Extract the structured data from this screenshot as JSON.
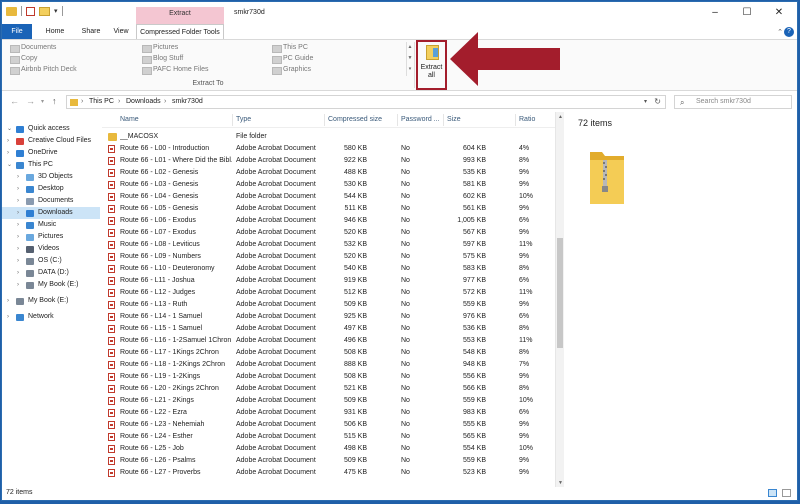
{
  "window": {
    "title": "smkr730d",
    "contextual_tab_label": "Extract"
  },
  "tabs": [
    "File",
    "Home",
    "Share",
    "View",
    "Compressed Folder Tools"
  ],
  "ribbon": {
    "destinations": [
      [
        "Documents",
        "Copy",
        "Airbnb Pitch Deck"
      ],
      [
        "Pictures",
        "Blog Stuff",
        "PAFC Home Files"
      ],
      [
        "This PC",
        "PC Guide",
        "Graphics"
      ]
    ],
    "group_label": "Extract To",
    "extract_all": [
      "Extract",
      "all"
    ]
  },
  "address": {
    "crumbs": [
      "This PC",
      "Downloads",
      "smkr730d"
    ],
    "search_placeholder": "Search smkr730d"
  },
  "nav": [
    {
      "label": "Quick access",
      "icon": "star-icon",
      "color": "#2f7fd3",
      "level": 0,
      "expanded": true
    },
    {
      "label": "Creative Cloud Files",
      "icon": "creative-cloud-icon",
      "color": "#d9413a",
      "level": 0
    },
    {
      "label": "OneDrive",
      "icon": "cloud-icon",
      "color": "#2f7fd3",
      "level": 0
    },
    {
      "label": "This PC",
      "icon": "pc-icon",
      "color": "#3a86d0",
      "level": 0,
      "expanded": true
    },
    {
      "label": "3D Objects",
      "icon": "cube-icon",
      "color": "#6aa8de",
      "level": 1
    },
    {
      "label": "Desktop",
      "icon": "desktop-icon",
      "color": "#3a86d0",
      "level": 1
    },
    {
      "label": "Documents",
      "icon": "document-icon",
      "color": "#8a9bb0",
      "level": 1
    },
    {
      "label": "Downloads",
      "icon": "download-icon",
      "color": "#2f7fd3",
      "level": 1,
      "selected": true
    },
    {
      "label": "Music",
      "icon": "music-icon",
      "color": "#3a86d0",
      "level": 1
    },
    {
      "label": "Pictures",
      "icon": "picture-icon",
      "color": "#6aa8de",
      "level": 1
    },
    {
      "label": "Videos",
      "icon": "video-icon",
      "color": "#556070",
      "level": 1
    },
    {
      "label": "OS (C:)",
      "icon": "drive-icon",
      "color": "#7a8796",
      "level": 1
    },
    {
      "label": "DATA (D:)",
      "icon": "drive-icon",
      "color": "#7a8796",
      "level": 1
    },
    {
      "label": "My Book (E:)",
      "icon": "drive-icon",
      "color": "#7a8796",
      "level": 1
    },
    {
      "label": "My Book (E:)",
      "icon": "drive-icon",
      "color": "#7a8796",
      "level": 0,
      "gap": true
    },
    {
      "label": "Network",
      "icon": "network-icon",
      "color": "#3a86d0",
      "level": 0,
      "gap": true
    }
  ],
  "columns": [
    "Name",
    "Type",
    "Compressed size",
    "Password ...",
    "Size",
    "Ratio"
  ],
  "files": [
    {
      "name": "__MACOSX",
      "type": "File folder",
      "csize": "",
      "pw": "",
      "size": "",
      "ratio": "",
      "folder": true
    },
    {
      "name": "Route 66 - L00 - Introduction",
      "type": "Adobe Acrobat Document",
      "csize": "580 KB",
      "pw": "No",
      "size": "604 KB",
      "ratio": "4%"
    },
    {
      "name": "Route 66 - L01 - Where Did the Bibl...",
      "type": "Adobe Acrobat Document",
      "csize": "922 KB",
      "pw": "No",
      "size": "993 KB",
      "ratio": "8%"
    },
    {
      "name": "Route 66 - L02 - Genesis",
      "type": "Adobe Acrobat Document",
      "csize": "488 KB",
      "pw": "No",
      "size": "535 KB",
      "ratio": "9%"
    },
    {
      "name": "Route 66 - L03 - Genesis",
      "type": "Adobe Acrobat Document",
      "csize": "530 KB",
      "pw": "No",
      "size": "581 KB",
      "ratio": "9%"
    },
    {
      "name": "Route 66 - L04 - Genesis",
      "type": "Adobe Acrobat Document",
      "csize": "544 KB",
      "pw": "No",
      "size": "602 KB",
      "ratio": "10%"
    },
    {
      "name": "Route 66 - L05 - Genesis",
      "type": "Adobe Acrobat Document",
      "csize": "511 KB",
      "pw": "No",
      "size": "561 KB",
      "ratio": "9%"
    },
    {
      "name": "Route 66 - L06 - Exodus",
      "type": "Adobe Acrobat Document",
      "csize": "946 KB",
      "pw": "No",
      "size": "1,005 KB",
      "ratio": "6%"
    },
    {
      "name": "Route 66 - L07 - Exodus",
      "type": "Adobe Acrobat Document",
      "csize": "520 KB",
      "pw": "No",
      "size": "567 KB",
      "ratio": "9%"
    },
    {
      "name": "Route 66 - L08 - Leviticus",
      "type": "Adobe Acrobat Document",
      "csize": "532 KB",
      "pw": "No",
      "size": "597 KB",
      "ratio": "11%"
    },
    {
      "name": "Route 66 - L09 - Numbers",
      "type": "Adobe Acrobat Document",
      "csize": "520 KB",
      "pw": "No",
      "size": "575 KB",
      "ratio": "9%"
    },
    {
      "name": "Route 66 - L10 - Deuteronomy",
      "type": "Adobe Acrobat Document",
      "csize": "540 KB",
      "pw": "No",
      "size": "583 KB",
      "ratio": "8%"
    },
    {
      "name": "Route 66 - L11 - Joshua",
      "type": "Adobe Acrobat Document",
      "csize": "919 KB",
      "pw": "No",
      "size": "977 KB",
      "ratio": "6%"
    },
    {
      "name": "Route 66 - L12 - Judges",
      "type": "Adobe Acrobat Document",
      "csize": "512 KB",
      "pw": "No",
      "size": "572 KB",
      "ratio": "11%"
    },
    {
      "name": "Route 66 - L13 - Ruth",
      "type": "Adobe Acrobat Document",
      "csize": "509 KB",
      "pw": "No",
      "size": "559 KB",
      "ratio": "9%"
    },
    {
      "name": "Route 66 - L14 - 1 Samuel",
      "type": "Adobe Acrobat Document",
      "csize": "925 KB",
      "pw": "No",
      "size": "976 KB",
      "ratio": "6%"
    },
    {
      "name": "Route 66 - L15 - 1 Samuel",
      "type": "Adobe Acrobat Document",
      "csize": "497 KB",
      "pw": "No",
      "size": "536 KB",
      "ratio": "8%"
    },
    {
      "name": "Route 66 - L16 - 1-2Samuel 1Chron",
      "type": "Adobe Acrobat Document",
      "csize": "496 KB",
      "pw": "No",
      "size": "553 KB",
      "ratio": "11%"
    },
    {
      "name": "Route 66 - L17 - 1Kings 2Chron",
      "type": "Adobe Acrobat Document",
      "csize": "508 KB",
      "pw": "No",
      "size": "548 KB",
      "ratio": "8%"
    },
    {
      "name": "Route 66 - L18 - 1-2Kings 2Chron",
      "type": "Adobe Acrobat Document",
      "csize": "888 KB",
      "pw": "No",
      "size": "948 KB",
      "ratio": "7%"
    },
    {
      "name": "Route 66 - L19 - 1-2Kings",
      "type": "Adobe Acrobat Document",
      "csize": "508 KB",
      "pw": "No",
      "size": "556 KB",
      "ratio": "9%"
    },
    {
      "name": "Route 66 - L20 - 2Kings 2Chron",
      "type": "Adobe Acrobat Document",
      "csize": "521 KB",
      "pw": "No",
      "size": "566 KB",
      "ratio": "8%"
    },
    {
      "name": "Route 66 - L21 - 2Kings",
      "type": "Adobe Acrobat Document",
      "csize": "509 KB",
      "pw": "No",
      "size": "559 KB",
      "ratio": "10%"
    },
    {
      "name": "Route 66 - L22 - Ezra",
      "type": "Adobe Acrobat Document",
      "csize": "931 KB",
      "pw": "No",
      "size": "983 KB",
      "ratio": "6%"
    },
    {
      "name": "Route 66 - L23 - Nehemiah",
      "type": "Adobe Acrobat Document",
      "csize": "506 KB",
      "pw": "No",
      "size": "555 KB",
      "ratio": "9%"
    },
    {
      "name": "Route 66 - L24 - Esther",
      "type": "Adobe Acrobat Document",
      "csize": "515 KB",
      "pw": "No",
      "size": "565 KB",
      "ratio": "9%"
    },
    {
      "name": "Route 66 - L25 - Job",
      "type": "Adobe Acrobat Document",
      "csize": "498 KB",
      "pw": "No",
      "size": "554 KB",
      "ratio": "10%"
    },
    {
      "name": "Route 66 - L26 - Psalms",
      "type": "Adobe Acrobat Document",
      "csize": "509 KB",
      "pw": "No",
      "size": "559 KB",
      "ratio": "9%"
    },
    {
      "name": "Route 66 - L27 - Proverbs",
      "type": "Adobe Acrobat Document",
      "csize": "475 KB",
      "pw": "No",
      "size": "523 KB",
      "ratio": "9%"
    }
  ],
  "preview": {
    "count": "72 items"
  },
  "status": {
    "text": "72 items"
  },
  "colors": {
    "accent": "#1a63b7",
    "annotation": "#a31d2c",
    "contextual_tab": "#f4c6d2",
    "selected": "#cce4f7"
  }
}
